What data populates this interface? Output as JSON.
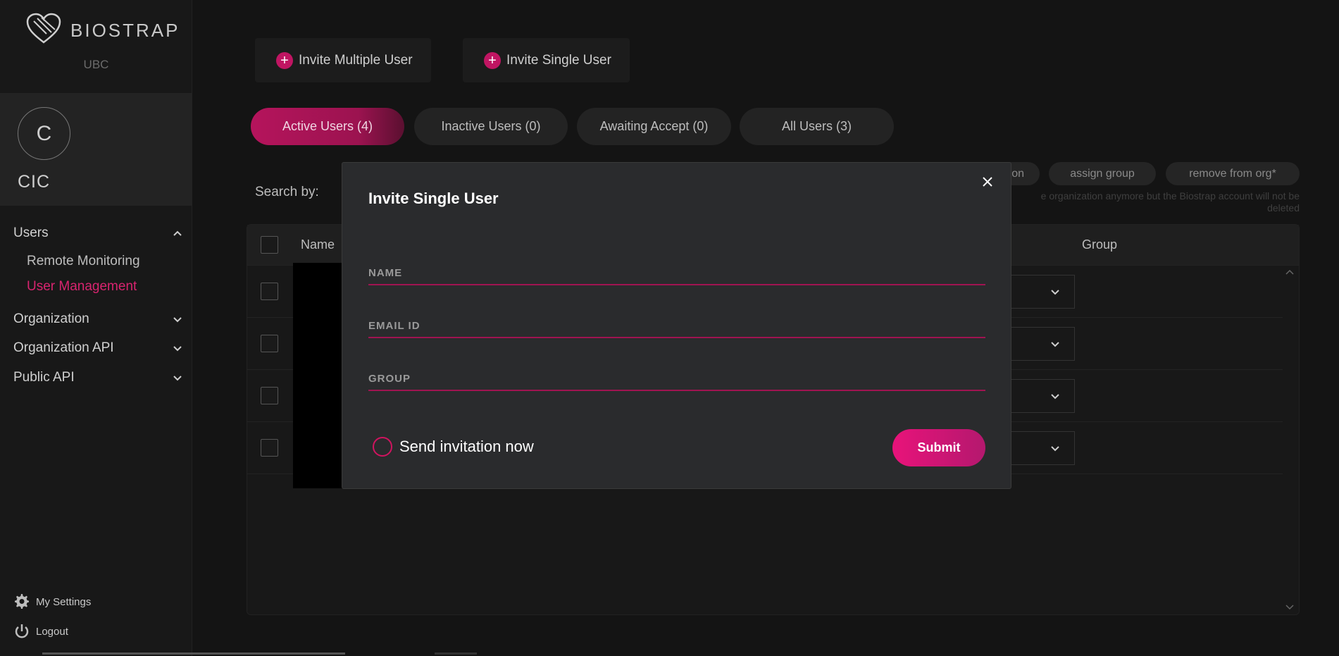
{
  "brand": {
    "name": "BIOSTRAP",
    "org_code": "UBC"
  },
  "org": {
    "avatar_letter": "C",
    "name": "CIC"
  },
  "sidebar": {
    "groups": [
      {
        "label": "Users",
        "expanded": true,
        "items": [
          {
            "label": "Remote Monitoring",
            "active": false
          },
          {
            "label": "User Management",
            "active": true
          }
        ]
      },
      {
        "label": "Organization",
        "expanded": false
      },
      {
        "label": "Organization API",
        "expanded": false
      },
      {
        "label": "Public API",
        "expanded": false
      }
    ],
    "footer": {
      "settings_label": "My Settings",
      "logout_label": "Logout"
    }
  },
  "toolbar": {
    "invite_multiple": "Invite Multiple User",
    "invite_single": "Invite Single User"
  },
  "tabs": [
    {
      "label": "Active Users (4)",
      "active": true
    },
    {
      "label": "Inactive Users (0)",
      "active": false
    },
    {
      "label": "Awaiting Accept (0)",
      "active": false
    },
    {
      "label": "All Users (3)",
      "active": false
    }
  ],
  "search": {
    "label": "Search by:"
  },
  "actions": {
    "partial_label": "on",
    "assign_group": "assign group",
    "remove_from_org": "remove from org*",
    "note_line1": "e organization anymore but the Biostrap account will not be",
    "note_line2": "deleted"
  },
  "table": {
    "columns": {
      "name": "Name",
      "group": "Group"
    },
    "row_count": 4
  },
  "modal": {
    "title": "Invite Single User",
    "fields": {
      "name_placeholder": "NAME",
      "email_placeholder": "EMAIL ID",
      "group_placeholder": "GROUP"
    },
    "send_invitation_label": "Send invitation now",
    "submit_label": "Submit"
  },
  "colors": {
    "accent": "#d0145f",
    "background": "#141414",
    "modal_bg": "#2a2b2d"
  }
}
